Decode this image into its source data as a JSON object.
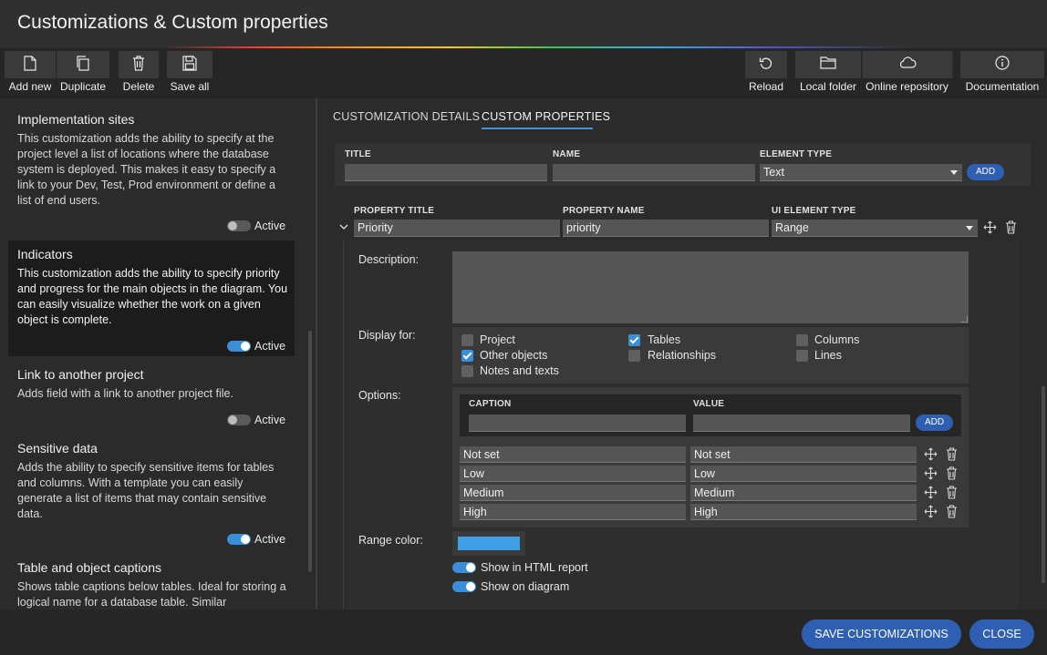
{
  "window": {
    "title": "Customizations & Custom properties"
  },
  "toolbar": {
    "add_new": "Add new",
    "duplicate": "Duplicate",
    "delete": "Delete",
    "save_all": "Save all",
    "reload": "Reload",
    "local_folder": "Local folder",
    "online_repository": "Online repository",
    "documentation": "Documentation"
  },
  "sidebar": {
    "items": [
      {
        "title": "Implementation sites",
        "description": "This customization adds the ability to specify at the project level a list of locations where the database system is deployed. This makes it easy to specify a link to your Dev, Test, Prod environment or define a list of end users.",
        "active_label": "Active",
        "active": false
      },
      {
        "title": "Indicators",
        "description": "This customization adds the ability to specify priority and progress for the main objects in the diagram. You can easily visualize whether the work on a given object is complete.",
        "active_label": "Active",
        "active": true
      },
      {
        "title": "Link to another project",
        "description": "Adds field with a link to another project file.",
        "active_label": "Active",
        "active": false
      },
      {
        "title": "Sensitive data",
        "description": "Adds the ability to specify sensitive items for tables and columns. With a template you can easily generate a list of items that may contain sensitive data.",
        "active_label": "Active",
        "active": true
      },
      {
        "title": "Table and object captions",
        "description": "Shows table captions below tables. Ideal for storing a logical name for a database table. Similar"
      }
    ]
  },
  "tabs": [
    {
      "label": "CUSTOMIZATION DETAILS",
      "active": false
    },
    {
      "label": "CUSTOM PROPERTIES",
      "active": true
    }
  ],
  "add_property": {
    "title_header": "TITLE",
    "name_header": "NAME",
    "type_header": "ELEMENT TYPE",
    "title_value": "",
    "name_value": "",
    "type_value": "Text",
    "add_label": "ADD"
  },
  "property": {
    "title_header": "PROPERTY TITLE",
    "name_header": "PROPERTY NAME",
    "ui_type_header": "UI ELEMENT TYPE",
    "title_value": "Priority",
    "name_value": "priority",
    "ui_type_value": "Range",
    "description_label": "Description:",
    "description_value": "",
    "display_for_label": "Display for:",
    "display_for": [
      {
        "label": "Project",
        "checked": false
      },
      {
        "label": "Tables",
        "checked": true
      },
      {
        "label": "Columns",
        "checked": false
      },
      {
        "label": "Other objects",
        "checked": true
      },
      {
        "label": "Relationships",
        "checked": false
      },
      {
        "label": "Lines",
        "checked": false
      },
      {
        "label": "Notes and texts",
        "checked": false
      }
    ],
    "options_label": "Options:",
    "caption_header": "CAPTION",
    "value_header": "VALUE",
    "options_add_label": "ADD",
    "options": [
      {
        "caption": "Not set",
        "value": "Not set"
      },
      {
        "caption": "Low",
        "value": "Low"
      },
      {
        "caption": "Medium",
        "value": "Medium"
      },
      {
        "caption": "High",
        "value": "High"
      }
    ],
    "range_color_label": "Range color:",
    "range_color": "#3fa0e6",
    "show_html_label": "Show in HTML report",
    "show_html": true,
    "show_diagram_label": "Show on diagram",
    "show_diagram": true
  },
  "footer": {
    "save_label": "SAVE CUSTOMIZATIONS",
    "close_label": "CLOSE"
  },
  "colors": {
    "accent": "#2f5fb3",
    "toggle_on": "#3b8fd9"
  }
}
